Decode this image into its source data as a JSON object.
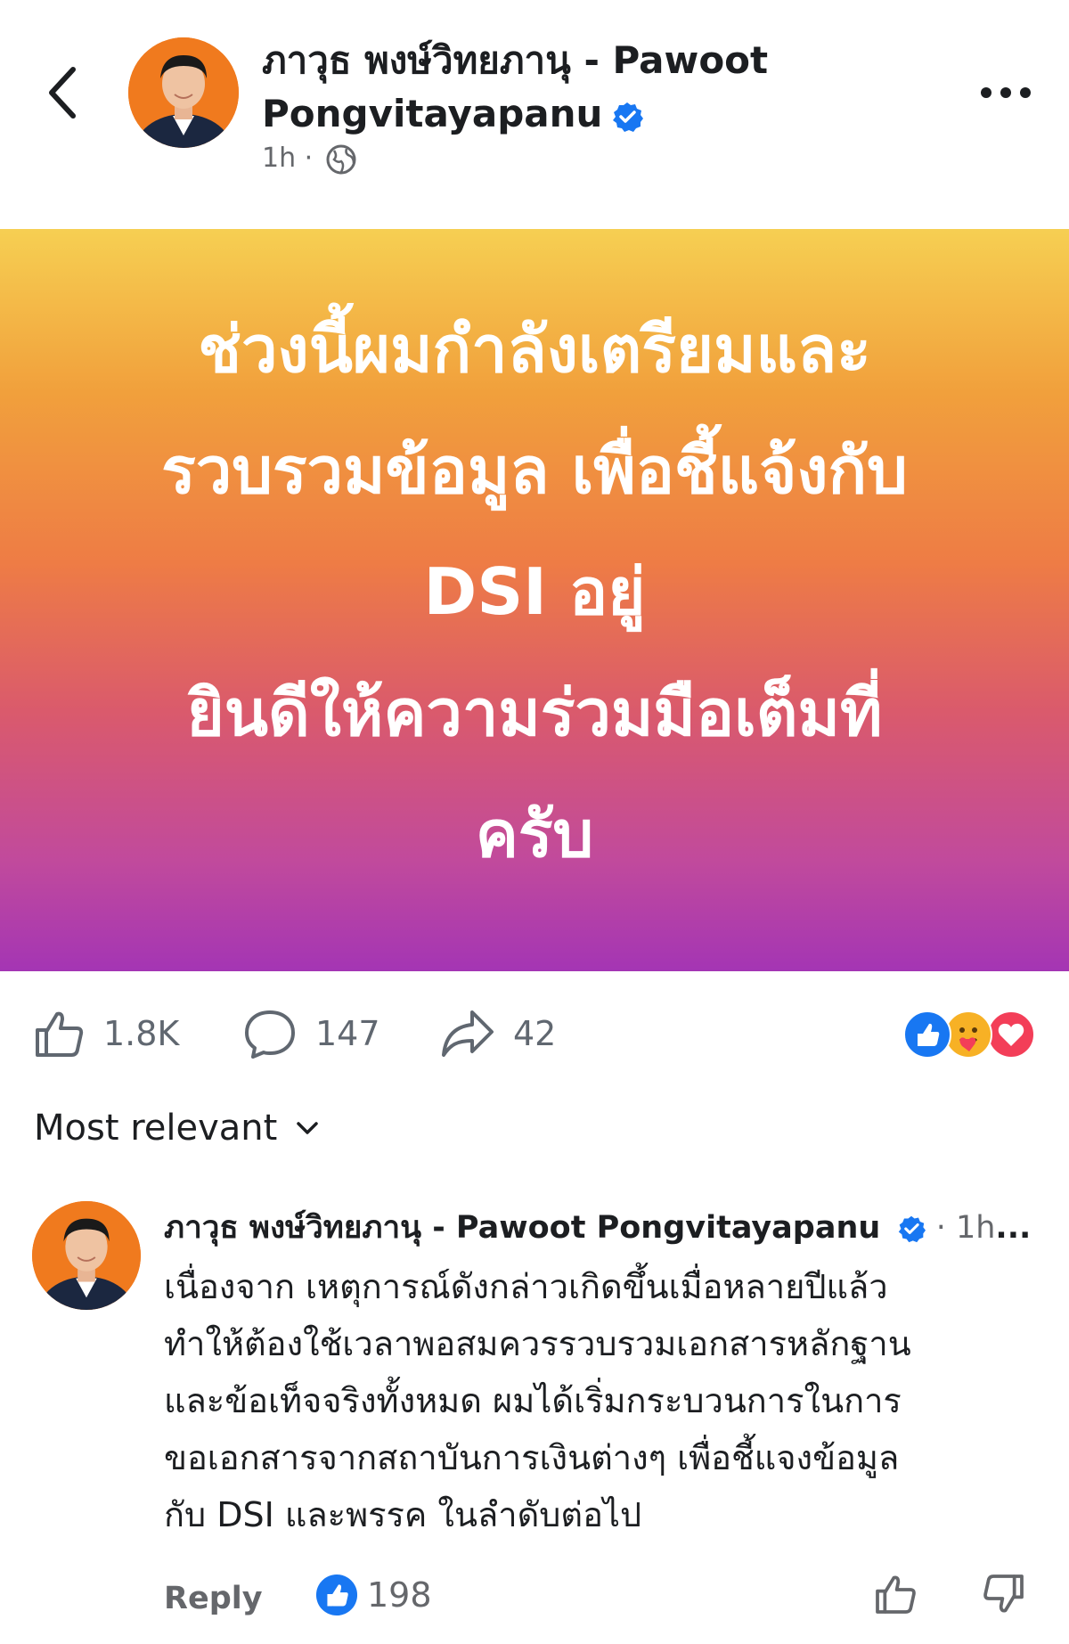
{
  "post": {
    "author": {
      "name": "ภาวุธ พงษ์วิทยภานุ - Pawoot Pongvitayapanu",
      "verified": true
    },
    "time": "1h",
    "privacy_icon": "globe-icon",
    "text_lines": [
      "ช่วงนี้ผมกำลังเตรียมและ",
      "รวบรวมข้อมูล เพื่อชี้แจ้งกับ",
      "DSI อยู่",
      "ยินดีให้ความร่วมมือเต็มที่",
      "ครับ"
    ],
    "background_gradient": [
      "#f6cf52",
      "#ee7c45",
      "#a435b4"
    ]
  },
  "actions": {
    "likes": "1.8K",
    "comments": "147",
    "shares": "42"
  },
  "reactions": [
    "like-icon",
    "care-icon",
    "love-icon"
  ],
  "sort": {
    "label": "Most relevant"
  },
  "comment": {
    "author": "ภาวุธ พงษ์วิทยภานุ - Pawoot Pongvitayapanu",
    "verified": true,
    "time": "1h",
    "lines": [
      "เนื่องจาก เหตุการณ์ดังกล่าวเกิดขึ้นเมื่อหลายปีแล้ว",
      "ทำให้ต้องใช้เวลาพอสมควรรวบรวมเอกสารหลักฐาน",
      "และข้อเท็จจริงทั้งหมด ผมได้เริ่มกระบวนการในการ",
      "ขอเอกสารจากสถาบันการเงินต่างๆ  เพื่อชี้แจงข้อมูล",
      "กับ DSI และพรรค ในลำดับต่อไป"
    ],
    "reply_label": "Reply",
    "like_count": "198"
  },
  "colors": {
    "facebook_blue": "#1877f2",
    "secondary_text": "#65676b",
    "love_red": "#f33e58",
    "care_yellow": "#f7b125"
  }
}
